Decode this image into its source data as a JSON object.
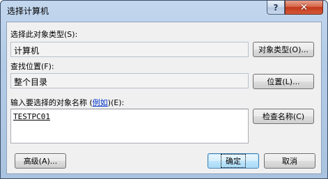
{
  "window": {
    "title": "选择计算机",
    "help_glyph": "?",
    "close_glyph": "✕"
  },
  "object_type": {
    "label": "选择此对象类型(S):",
    "value": "计算机",
    "button": "对象类型(O)..."
  },
  "location": {
    "label": "查找位置(F):",
    "value": "整个目录",
    "button": "位置(L)..."
  },
  "names": {
    "label_prefix": "输入要选择的对象名称 (",
    "examples_link": "例如",
    "label_suffix": ")(E):",
    "entered_text": "TESTPC01",
    "check_button": "检查名称(C)"
  },
  "footer": {
    "advanced_button": "高级(A)...",
    "ok_button": "确定",
    "cancel_button": "取消"
  },
  "colors": {
    "title_gradient_top": "#c3d7ee",
    "close_button_red": "#c2381a",
    "link_blue": "#0033cc",
    "dialog_face": "#f0f0f0"
  }
}
